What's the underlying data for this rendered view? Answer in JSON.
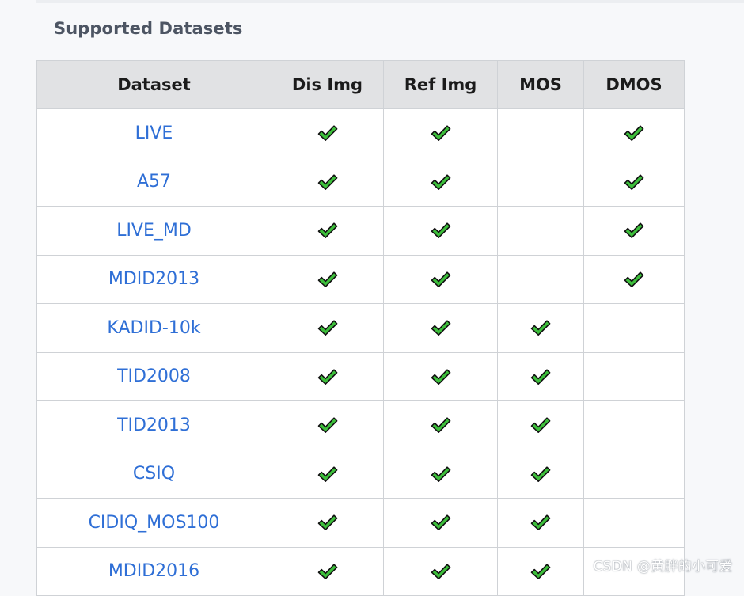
{
  "section_title": "Supported Datasets",
  "table": {
    "headers": [
      "Dataset",
      "Dis Img",
      "Ref Img",
      "MOS",
      "DMOS"
    ],
    "rows": [
      {
        "name": "LIVE",
        "dis_img": true,
        "ref_img": true,
        "mos": false,
        "dmos": true
      },
      {
        "name": "A57",
        "dis_img": true,
        "ref_img": true,
        "mos": false,
        "dmos": true
      },
      {
        "name": "LIVE_MD",
        "dis_img": true,
        "ref_img": true,
        "mos": false,
        "dmos": true
      },
      {
        "name": "MDID2013",
        "dis_img": true,
        "ref_img": true,
        "mos": false,
        "dmos": true
      },
      {
        "name": "KADID-10k",
        "dis_img": true,
        "ref_img": true,
        "mos": true,
        "dmos": false
      },
      {
        "name": "TID2008",
        "dis_img": true,
        "ref_img": true,
        "mos": true,
        "dmos": false
      },
      {
        "name": "TID2013",
        "dis_img": true,
        "ref_img": true,
        "mos": true,
        "dmos": false
      },
      {
        "name": "CSIQ",
        "dis_img": true,
        "ref_img": true,
        "mos": true,
        "dmos": false
      },
      {
        "name": "CIDIQ_MOS100",
        "dis_img": true,
        "ref_img": true,
        "mos": true,
        "dmos": false
      },
      {
        "name": "MDID2016",
        "dis_img": true,
        "ref_img": true,
        "mos": true,
        "dmos": false
      }
    ]
  },
  "check_icon": "heavy-check-mark-icon",
  "colors": {
    "link": "#2f6fd6",
    "check_fill": "#3dbf3b",
    "header_bg": "#e1e2e4"
  },
  "watermark": "CSDN @黄胖的小可爱"
}
